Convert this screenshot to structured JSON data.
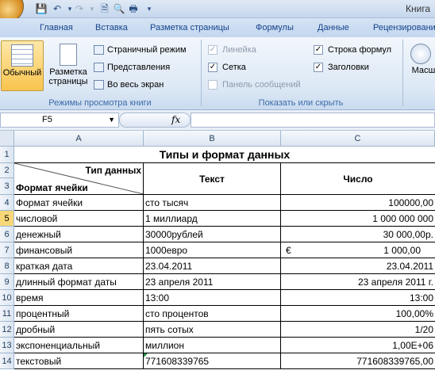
{
  "title": "Книга",
  "tabs": [
    "Главная",
    "Вставка",
    "Разметка страницы",
    "Формулы",
    "Данные",
    "Рецензирование"
  ],
  "ribbon": {
    "views_group": {
      "label": "Режимы просмотра книги",
      "normal": "Обычный",
      "page_layout_1": "Разметка",
      "page_layout_2": "страницы",
      "page_mode": "Страничный режим",
      "views": "Представления",
      "fullscreen": "Во весь экран"
    },
    "show_group": {
      "label": "Показать или скрыть",
      "ruler": "Линейка",
      "grid": "Сетка",
      "message_bar": "Панель сообщений",
      "formula_bar": "Строка формул",
      "headings": "Заголовки"
    },
    "zoom_label": "Масшт"
  },
  "formula_bar": {
    "name_box": "F5",
    "fx": "fx",
    "value": ""
  },
  "columns": [
    "A",
    "B",
    "C"
  ],
  "rows": [
    "1",
    "2",
    "3",
    "4",
    "5",
    "6",
    "7",
    "8",
    "9",
    "10",
    "11",
    "12",
    "13",
    "14"
  ],
  "sheet": {
    "title": "Типы  и формат данных",
    "header_type": "Тип данных",
    "header_format": "Формат ячейки",
    "header_text": "Текст",
    "header_number": "Число",
    "data": [
      {
        "a": "Формат ячейки",
        "b": "сто тысяч",
        "c": "100000,00",
        "cprefix": ""
      },
      {
        "a": "числовой",
        "b": "1 миллиард",
        "c": "1 000 000 000",
        "cprefix": ""
      },
      {
        "a": "денежный",
        "b": "30000рублей",
        "c": "30 000,00р.",
        "cprefix": ""
      },
      {
        "a": "финансовый",
        "b": "1000евро",
        "c": "1 000,00",
        "cprefix": "€"
      },
      {
        "a": "краткая дата",
        "b": "23.04.2011",
        "c": "23.04.2011",
        "cprefix": ""
      },
      {
        "a": "длинный формат даты",
        "b": "23 апреля 2011",
        "c": "23 апреля 2011 г.",
        "cprefix": ""
      },
      {
        "a": "время",
        "b": "13:00",
        "c": "13:00",
        "cprefix": ""
      },
      {
        "a": "процентный",
        "b": "сто процентов",
        "c": "100,00%",
        "cprefix": ""
      },
      {
        "a": "дробный",
        "b": "пять сотых",
        "c": "1/20",
        "cprefix": ""
      },
      {
        "a": "экспоненциальный",
        "b": "миллион",
        "c": "1,00E+06",
        "cprefix": ""
      },
      {
        "a": "текстовый",
        "b": "771608339765",
        "c": "771608339765,00",
        "cprefix": ""
      }
    ]
  }
}
